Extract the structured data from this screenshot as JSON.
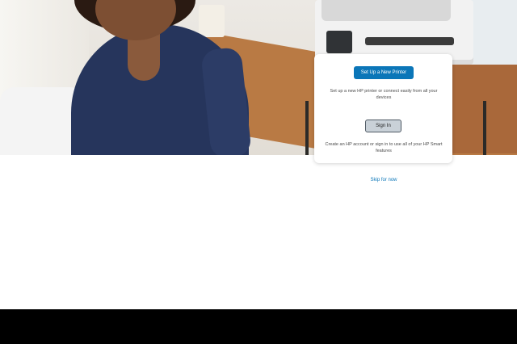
{
  "hero": {
    "image_description_name": "woman-at-desk-with-printer-photo"
  },
  "card": {
    "setup_button_label": "Set Up a New Printer",
    "setup_description": "Set up a new HP printer or connect easily from all your devices",
    "signin_button_label": "Sign In",
    "signin_description": "Create an HP account or sign in to use all of your HP Smart features"
  },
  "skip_link_label": "Skip for now",
  "colors": {
    "primary_button": "#0b76b8",
    "secondary_button": "#c9d1d8",
    "link": "#0b76b8",
    "bottom_bar": "#000000"
  }
}
